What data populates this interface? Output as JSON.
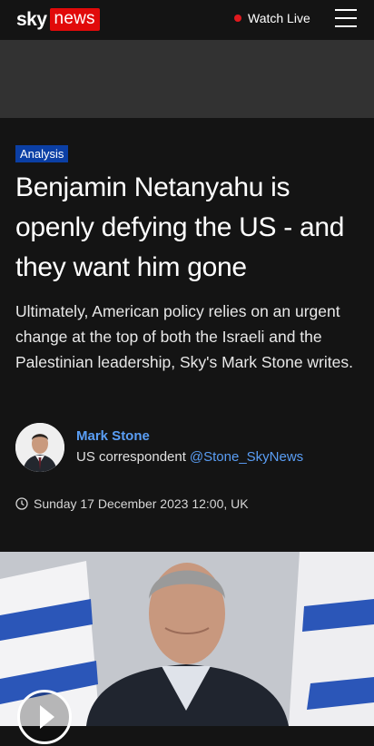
{
  "header": {
    "logo_sky": "sky",
    "logo_news": "news",
    "watch_live_label": "Watch Live",
    "live_dot_color": "#e1191e",
    "menu_icon": "hamburger-menu-icon"
  },
  "article": {
    "category_badge": "Analysis",
    "headline": "Benjamin Netanyahu is openly defying the US - and they want him gone",
    "standfirst": "Ultimately, American policy relies on an urgent change at the top of both the Israeli and the Palestinian leadership, Sky's Mark Stone writes.",
    "author": {
      "name": "Mark Stone",
      "role": "US correspondent",
      "handle": "@Stone_SkyNews"
    },
    "date": "Sunday 17 December 2023 12:00, UK",
    "accent_color": "#5a9ef5",
    "badge_color": "#0b3fa5"
  },
  "media": {
    "play_icon": "play-icon"
  }
}
